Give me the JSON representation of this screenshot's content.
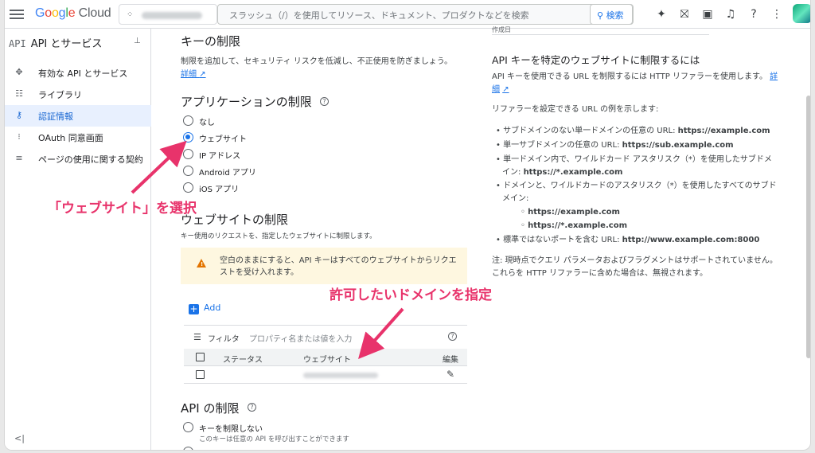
{
  "header": {
    "logo": {
      "g": "G",
      "o1": "o",
      "o2": "o",
      "g2": "g",
      "l": "l",
      "e": "e",
      "cloud": "Cloud"
    },
    "search_placeholder": "スラッシュ（/）を使用してリソース、ドキュメント、プロダクトなどを検索",
    "search_button": "検索",
    "icons": [
      "gemini-icon",
      "gift-icon",
      "terminal-icon",
      "bell-icon",
      "help-icon",
      "more-icon"
    ]
  },
  "sidebar": {
    "badge": "API",
    "title": "API とサービス",
    "items": [
      {
        "label": "有効な API とサービス",
        "icon": "✥"
      },
      {
        "label": "ライブラリ",
        "icon": "☷"
      },
      {
        "label": "認証情報",
        "icon": "⚷"
      },
      {
        "label": "OAuth 同意画面",
        "icon": "⁝"
      },
      {
        "label": "ページの使用に関する契約",
        "icon": "≡"
      }
    ],
    "collapse": "<|"
  },
  "main": {
    "key_restriction_title": "キーの制限",
    "key_restriction_desc": "制限を追加して、セキュリティ リスクを低減し、不正使用を防ぎましょう。",
    "details_link": "詳細",
    "app_restriction_title": "アプリケーションの制限",
    "app_options": [
      "なし",
      "ウェブサイト",
      "IP アドレス",
      "Android アプリ",
      "iOS アプリ"
    ],
    "website_restriction_title": "ウェブサイトの制限",
    "website_restriction_desc": "キー使用のリクエストを、指定したウェブサイトに制限します。",
    "warning_text": "空白のままにすると、API キーはすべてのウェブサイトからリクエストを受け入れます。",
    "add_label": "Add",
    "filter_label": "フィルタ",
    "filter_placeholder": "プロパティ名または値を入力",
    "table_headers": {
      "status": "ステータス",
      "website": "ウェブサイト",
      "edit": "編集"
    },
    "api_restriction_title": "API の制限",
    "api_option": "キーを制限しない",
    "api_option_desc": "このキーは任意の API を呼び出すことができます"
  },
  "right_panel": {
    "top_partial": "作成日",
    "title": "API キーを特定のウェブサイトに制限するには",
    "intro": "API キーを使用できる URL を制限するには HTTP リファラーを使用します。",
    "intro_link_1": "詳",
    "intro_link_2": "細",
    "examples_intro": "リファラーを設定できる URL の例を示します:",
    "bullets": [
      {
        "text": "サブドメインのない単一ドメインの任意の URL: ",
        "bold": "https://example.com"
      },
      {
        "text": "単一サブドメインの任意の URL: ",
        "bold": "https://sub.example.com"
      },
      {
        "text": "単一ドメイン内で、ワイルドカード アスタリスク（*）を使用したサブドメ",
        "text2": "イン: ",
        "bold": "https://*.example.com"
      },
      {
        "text": "ドメインと、ワイルドカードのアスタリスク（*）を使用したすべてのサブド",
        "text2": "メイン:"
      },
      {
        "sub": true,
        "bold": "https://example.com"
      },
      {
        "sub": true,
        "bold": "https://*.example.com"
      },
      {
        "text": "標準ではないポートを含む URL: ",
        "bold": "http://www.example.com:8000"
      }
    ],
    "note_1": "注: 現時点でクエリ パラメータおよびフラグメントはサポートされていません。",
    "note_2": "これらを HTTP リファラーに含めた場合は、無視されます。"
  },
  "annotations": {
    "select_website": "「ウェブサイト」を選択",
    "specify_domain": "許可したいドメインを指定"
  },
  "colors": {
    "accent": "#1a73e8",
    "annotation": "#e8336b",
    "warning_bg": "#fef7e0"
  }
}
